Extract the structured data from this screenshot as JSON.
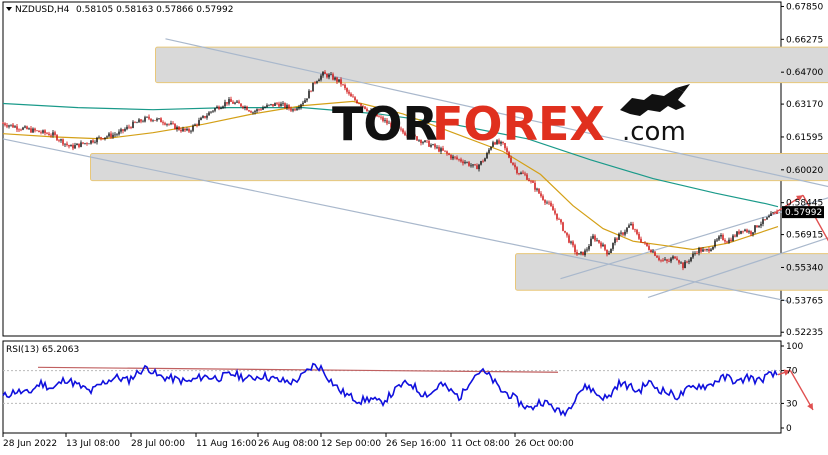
{
  "header": {
    "symbol": "NZDUSD,H4",
    "ohlc": "0.58105 0.58163 0.57866 0.57992"
  },
  "rsi_header": "RSI(13) 65.2063",
  "logo": {
    "part1": "TOR",
    "part2": "FOREX",
    "part3": ".com"
  },
  "colors": {
    "background": "#ffffff",
    "bull_candle": "#000000",
    "bear_candle": "#cc0000",
    "ma_fast": "#d4a017",
    "ma_slow": "#1a9a8a",
    "channel": "#a9b8cc",
    "zone_fill": "#d9d9d9",
    "zone_border": "#e8c77a",
    "rsi_line": "#1010dd",
    "rsi_trend": "#c06060",
    "arrow": "#e05050",
    "price_badge": "#000000",
    "logo_dark": "#111111",
    "logo_red": "#e0301e"
  },
  "chart_data": [
    {
      "type": "line",
      "name": "price",
      "y_ticks": [
        "0.67850",
        "0.66275",
        "0.64700",
        "0.63170",
        "0.61595",
        "0.60020",
        "0.58445",
        "0.56915",
        "0.55340",
        "0.53765",
        "0.52235"
      ],
      "current_price": "0.57992",
      "x_ticks": [
        "28 Jun 2022",
        "13 Jul 08:00",
        "28 Jul 00:00",
        "11 Aug 16:00",
        "26 Aug 08:00",
        "12 Sep 00:00",
        "26 Sep 16:00",
        "11 Oct 08:00",
        "26 Oct 00:00"
      ],
      "ylim": [
        0.5215,
        0.6792
      ],
      "price_path": [
        [
          0,
          0.6225
        ],
        [
          6,
          0.6205
        ],
        [
          12,
          0.619
        ],
        [
          20,
          0.617
        ],
        [
          27,
          0.611
        ],
        [
          34,
          0.6135
        ],
        [
          40,
          0.616
        ],
        [
          46,
          0.6175
        ],
        [
          52,
          0.622
        ],
        [
          58,
          0.625
        ],
        [
          64,
          0.6235
        ],
        [
          70,
          0.62
        ],
        [
          74,
          0.6185
        ],
        [
          78,
          0.623
        ],
        [
          84,
          0.629
        ],
        [
          90,
          0.633
        ],
        [
          96,
          0.631
        ],
        [
          100,
          0.628
        ],
        [
          104,
          0.63
        ],
        [
          110,
          0.632
        ],
        [
          116,
          0.629
        ],
        [
          121,
          0.634
        ],
        [
          125,
          0.643
        ],
        [
          128,
          0.646
        ],
        [
          131,
          0.645
        ],
        [
          135,
          0.642
        ],
        [
          139,
          0.635
        ],
        [
          143,
          0.632
        ],
        [
          148,
          0.627
        ],
        [
          152,
          0.624
        ],
        [
          157,
          0.62
        ],
        [
          162,
          0.617
        ],
        [
          166,
          0.615
        ],
        [
          171,
          0.612
        ],
        [
          176,
          0.609
        ],
        [
          180,
          0.606
        ],
        [
          185,
          0.604
        ],
        [
          189,
          0.601
        ],
        [
          193,
          0.606
        ],
        [
          196,
          0.614
        ],
        [
          200,
          0.612
        ],
        [
          203,
          0.605
        ],
        [
          206,
          0.599
        ],
        [
          209,
          0.5975
        ],
        [
          212,
          0.593
        ],
        [
          215,
          0.588
        ],
        [
          218,
          0.584
        ],
        [
          221,
          0.579
        ],
        [
          224,
          0.572
        ],
        [
          227,
          0.565
        ],
        [
          230,
          0.559
        ],
        [
          233,
          0.561
        ],
        [
          236,
          0.568
        ],
        [
          239,
          0.565
        ],
        [
          242,
          0.56
        ],
        [
          245,
          0.567
        ],
        [
          248,
          0.57
        ],
        [
          251,
          0.574
        ],
        [
          254,
          0.568
        ],
        [
          257,
          0.564
        ],
        [
          260,
          0.561
        ],
        [
          263,
          0.557
        ],
        [
          266,
          0.556
        ],
        [
          269,
          0.559
        ],
        [
          272,
          0.554
        ],
        [
          275,
          0.558
        ],
        [
          278,
          0.562
        ],
        [
          281,
          0.561
        ],
        [
          284,
          0.564
        ],
        [
          287,
          0.568
        ],
        [
          290,
          0.566
        ],
        [
          293,
          0.569
        ],
        [
          296,
          0.572
        ],
        [
          299,
          0.57
        ],
        [
          302,
          0.574
        ],
        [
          305,
          0.576
        ],
        [
          308,
          0.579
        ],
        [
          310,
          0.58
        ]
      ],
      "ma_fast_path": [
        [
          0,
          0.6175
        ],
        [
          20,
          0.616
        ],
        [
          40,
          0.615
        ],
        [
          60,
          0.618
        ],
        [
          80,
          0.622
        ],
        [
          100,
          0.627
        ],
        [
          120,
          0.631
        ],
        [
          140,
          0.633
        ],
        [
          160,
          0.627
        ],
        [
          180,
          0.618
        ],
        [
          200,
          0.609
        ],
        [
          215,
          0.598
        ],
        [
          228,
          0.583
        ],
        [
          240,
          0.572
        ],
        [
          252,
          0.566
        ],
        [
          264,
          0.564
        ],
        [
          276,
          0.562
        ],
        [
          290,
          0.565
        ],
        [
          300,
          0.569
        ],
        [
          310,
          0.573
        ]
      ],
      "ma_slow_path": [
        [
          0,
          0.632
        ],
        [
          30,
          0.63
        ],
        [
          60,
          0.629
        ],
        [
          90,
          0.63
        ],
        [
          120,
          0.63
        ],
        [
          150,
          0.627
        ],
        [
          180,
          0.622
        ],
        [
          210,
          0.615
        ],
        [
          235,
          0.605
        ],
        [
          260,
          0.596
        ],
        [
          285,
          0.589
        ],
        [
          305,
          0.584
        ],
        [
          310,
          0.5825
        ]
      ],
      "upper_channel": [
        [
          65,
          0.663
        ],
        [
          415,
          0.5695
        ]
      ],
      "lower_channel": [
        [
          0,
          0.615
        ],
        [
          315,
          0.537
        ]
      ],
      "rising_channel": [
        [
          [
            223,
            0.548
          ],
          [
            339,
            0.59
          ]
        ],
        [
          [
            258,
            0.539
          ],
          [
            374,
            0.585
          ]
        ]
      ],
      "zones": [
        {
          "x0": 61,
          "x1": 460,
          "y_top": 0.659,
          "y_bottom": 0.642
        },
        {
          "x0": 35,
          "x1": 405,
          "y_top": 0.608,
          "y_bottom": 0.595
        },
        {
          "x0": 205,
          "x1": 462,
          "y_top": 0.56,
          "y_bottom": 0.5425
        }
      ],
      "forecast_arrows": [
        {
          "x0": 308,
          "y0": 0.579,
          "x1": 320,
          "y1": 0.588
        },
        {
          "x0": 320,
          "y0": 0.588,
          "x1": 340,
          "y1": 0.545
        }
      ]
    },
    {
      "type": "line",
      "name": "RSI(13)",
      "y_ticks": [
        "100",
        "70",
        "30",
        "0"
      ],
      "ylim": [
        0,
        100
      ],
      "levels": [
        70,
        30
      ],
      "rsi_path": [
        [
          0,
          38
        ],
        [
          5,
          45
        ],
        [
          10,
          42
        ],
        [
          15,
          55
        ],
        [
          20,
          48
        ],
        [
          25,
          60
        ],
        [
          30,
          52
        ],
        [
          35,
          44
        ],
        [
          40,
          55
        ],
        [
          45,
          62
        ],
        [
          50,
          58
        ],
        [
          55,
          70
        ],
        [
          58,
          74
        ],
        [
          62,
          63
        ],
        [
          68,
          60
        ],
        [
          74,
          56
        ],
        [
          80,
          63
        ],
        [
          86,
          61
        ],
        [
          92,
          66
        ],
        [
          98,
          60
        ],
        [
          104,
          64
        ],
        [
          110,
          58
        ],
        [
          116,
          56
        ],
        [
          120,
          64
        ],
        [
          124,
          76
        ],
        [
          127,
          74
        ],
        [
          131,
          58
        ],
        [
          135,
          45
        ],
        [
          139,
          38
        ],
        [
          143,
          33
        ],
        [
          147,
          36
        ],
        [
          151,
          30
        ],
        [
          155,
          40
        ],
        [
          159,
          52
        ],
        [
          163,
          55
        ],
        [
          167,
          43
        ],
        [
          171,
          41
        ],
        [
          175,
          54
        ],
        [
          179,
          45
        ],
        [
          183,
          37
        ],
        [
          187,
          60
        ],
        [
          191,
          70
        ],
        [
          195,
          62
        ],
        [
          199,
          46
        ],
        [
          203,
          40
        ],
        [
          207,
          30
        ],
        [
          211,
          23
        ],
        [
          215,
          33
        ],
        [
          219,
          28
        ],
        [
          223,
          18
        ],
        [
          226,
          22
        ],
        [
          230,
          44
        ],
        [
          234,
          51
        ],
        [
          238,
          40
        ],
        [
          242,
          36
        ],
        [
          246,
          54
        ],
        [
          250,
          52
        ],
        [
          254,
          44
        ],
        [
          258,
          56
        ],
        [
          262,
          48
        ],
        [
          266,
          43
        ],
        [
          270,
          38
        ],
        [
          274,
          47
        ],
        [
          278,
          52
        ],
        [
          282,
          51
        ],
        [
          286,
          59
        ],
        [
          290,
          62
        ],
        [
          294,
          55
        ],
        [
          298,
          63
        ],
        [
          302,
          57
        ],
        [
          306,
          64
        ],
        [
          310,
          65
        ]
      ],
      "trend_line": [
        [
          0,
          74
        ],
        [
          332,
          68
        ]
      ],
      "forecast_arrows": [
        {
          "x0": 310,
          "y0": 65,
          "x1": 315,
          "y1": 70
        },
        {
          "x0": 315,
          "y0": 70,
          "x1": 324,
          "y1": 22
        }
      ]
    }
  ]
}
